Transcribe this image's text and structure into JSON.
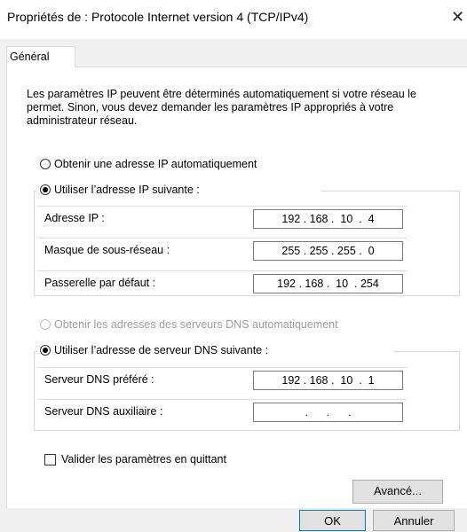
{
  "window": {
    "title": "Propriétés de : Protocole Internet version 4 (TCP/IPv4)",
    "close_glyph": "✕"
  },
  "tabs": [
    {
      "label": "Général"
    }
  ],
  "description": "Les paramètres IP peuvent être déterminés automatiquement si votre réseau le permet. Sinon, vous devez demander les paramètres IP appropriés à votre administrateur réseau.",
  "ip_section": {
    "auto_label": "Obtenir une adresse IP automatiquement",
    "manual_label": "Utiliser l’adresse IP suivante :",
    "selected": "manual",
    "fields": [
      {
        "label": "Adresse IP :",
        "value": "192 . 168 .  10  .  4"
      },
      {
        "label": "Masque de sous-réseau :",
        "value": "255 . 255 . 255 .  0"
      },
      {
        "label": "Passerelle par défaut :",
        "value": "192 . 168 .  10  . 254"
      }
    ]
  },
  "dns_section": {
    "auto_label": "Obtenir les adresses des serveurs DNS automatiquement",
    "auto_enabled": false,
    "manual_label": "Utiliser l’adresse de serveur DNS suivante :",
    "selected": "manual",
    "fields": [
      {
        "label": "Serveur DNS préféré :",
        "value": "192 . 168 .  10  .  1"
      },
      {
        "label": "Serveur DNS auxiliaire :",
        "value": "  .      .      .  "
      }
    ]
  },
  "validate_checkbox": {
    "label": "Valider les paramètres en quittant",
    "checked": false
  },
  "buttons": {
    "advanced": "Avancé...",
    "ok": "OK",
    "cancel": "Annuler"
  }
}
